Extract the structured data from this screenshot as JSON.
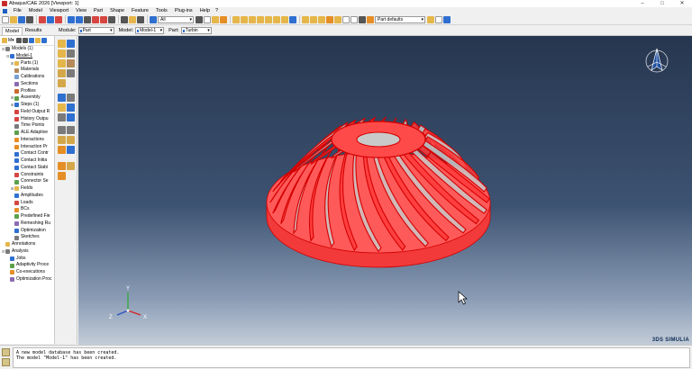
{
  "window": {
    "title": "Abaqus/CAE 2026 [Viewport: 1]",
    "controls": [
      "minimize-icon",
      "maximize-icon",
      "close-icon"
    ]
  },
  "menubar": {
    "items": [
      "File",
      "Model",
      "Viewport",
      "View",
      "Part",
      "Shape",
      "Feature",
      "Tools",
      "Plug-ins",
      "Help"
    ],
    "help_icon": "?"
  },
  "toolbar": {
    "selection_filter": "All",
    "render_style": "Part defaults"
  },
  "context": {
    "tabs": [
      "Model",
      "Results"
    ],
    "active_tab": "Model",
    "module_label": "Module:",
    "module_value": "Part",
    "model_label": "Model:",
    "model_value": "Model-1",
    "part_label": "Part:",
    "part_value": "Turbin"
  },
  "tree": {
    "filter_value": "M▾",
    "items": [
      {
        "label": "Models (1)",
        "depth": 0,
        "exp": "⊟",
        "color": "#7a7a7a"
      },
      {
        "label": "Model-1",
        "depth": 1,
        "exp": "⊟",
        "color": "#2f6fd0",
        "underline": true
      },
      {
        "label": "Parts (1)",
        "depth": 2,
        "exp": "⊞",
        "color": "#e5b64a"
      },
      {
        "label": "Materials",
        "depth": 2,
        "exp": "",
        "color": "#b58a5a"
      },
      {
        "label": "Calibrations",
        "depth": 2,
        "exp": "",
        "color": "#7a9fd0"
      },
      {
        "label": "Sections",
        "depth": 2,
        "exp": "",
        "color": "#8a6bb0"
      },
      {
        "label": "Profiles",
        "depth": 2,
        "exp": "",
        "color": "#c96a2a"
      },
      {
        "label": "Assembly",
        "depth": 2,
        "exp": "⊞",
        "color": "#5da04b"
      },
      {
        "label": "Steps (1)",
        "depth": 2,
        "exp": "⊞",
        "color": "#2f6fd0"
      },
      {
        "label": "Field Output R",
        "depth": 2,
        "exp": "",
        "color": "#d64541"
      },
      {
        "label": "History Outpu",
        "depth": 2,
        "exp": "",
        "color": "#d64541"
      },
      {
        "label": "Time Points",
        "depth": 2,
        "exp": "",
        "color": "#7a7a7a"
      },
      {
        "label": "ALE Adaptive",
        "depth": 2,
        "exp": "",
        "color": "#5da04b"
      },
      {
        "label": "Interactions",
        "depth": 2,
        "exp": "",
        "color": "#e58e26"
      },
      {
        "label": "Interaction Pr",
        "depth": 2,
        "exp": "",
        "color": "#e58e26"
      },
      {
        "label": "Contact Contr",
        "depth": 2,
        "exp": "",
        "color": "#2f6fd0"
      },
      {
        "label": "Contact Initia",
        "depth": 2,
        "exp": "",
        "color": "#2f6fd0"
      },
      {
        "label": "Contact Stabi",
        "depth": 2,
        "exp": "",
        "color": "#2f6fd0"
      },
      {
        "label": "Constraints",
        "depth": 2,
        "exp": "",
        "color": "#d64541"
      },
      {
        "label": "Connector Se",
        "depth": 2,
        "exp": "",
        "color": "#5da04b"
      },
      {
        "label": "Fields",
        "depth": 2,
        "exp": "⊞",
        "color": "#e5b64a"
      },
      {
        "label": "Amplitudes",
        "depth": 2,
        "exp": "",
        "color": "#2f6fd0"
      },
      {
        "label": "Loads",
        "depth": 2,
        "exp": "",
        "color": "#d64541"
      },
      {
        "label": "BCs",
        "depth": 2,
        "exp": "",
        "color": "#e58e26"
      },
      {
        "label": "Predefined Fie",
        "depth": 2,
        "exp": "",
        "color": "#5da04b"
      },
      {
        "label": "Remeshing Ru",
        "depth": 2,
        "exp": "",
        "color": "#8a6bb0"
      },
      {
        "label": "Optimization",
        "depth": 2,
        "exp": "",
        "color": "#2f6fd0"
      },
      {
        "label": "Sketches",
        "depth": 2,
        "exp": "",
        "color": "#7a7a7a"
      },
      {
        "label": "Annotations",
        "depth": 0,
        "exp": "",
        "color": "#e5b64a"
      },
      {
        "label": "Analysis",
        "depth": 0,
        "exp": "⊟",
        "color": "#7a7a7a"
      },
      {
        "label": "Jobs",
        "depth": 1,
        "exp": "",
        "color": "#2f6fd0"
      },
      {
        "label": "Adaptivity Proce",
        "depth": 1,
        "exp": "",
        "color": "#5da04b"
      },
      {
        "label": "Co-executions",
        "depth": 1,
        "exp": "",
        "color": "#e58e26"
      },
      {
        "label": "Optimization Proc",
        "depth": 1,
        "exp": "",
        "color": "#8a6bb0"
      }
    ]
  },
  "viewport": {
    "brand": "3DS SIMULIA",
    "triad_labels": {
      "y": "Y",
      "z": "Z",
      "x": "X"
    },
    "part_color": "#ff2a2a",
    "edge_color": "#d40000",
    "background_top": "#26364f",
    "background_bottom": "#c3ccd8"
  },
  "messages": {
    "lines": [
      "A new model database has been created.",
      "The model \"Model-1\" has been created."
    ]
  }
}
